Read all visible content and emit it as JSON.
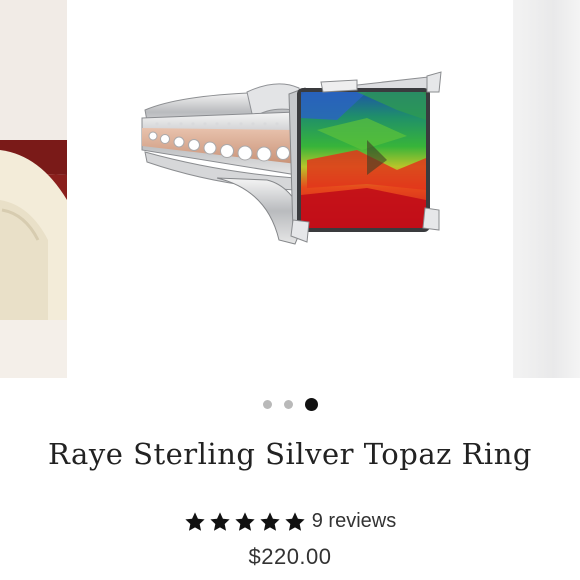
{
  "product": {
    "title": "Raye Sterling Silver Topaz Ring",
    "rating": 5,
    "reviews_label": "9 reviews",
    "price": "$220.00"
  },
  "carousel": {
    "slide_count": 3,
    "active_index": 2
  },
  "icons": {
    "star": "star-icon"
  }
}
